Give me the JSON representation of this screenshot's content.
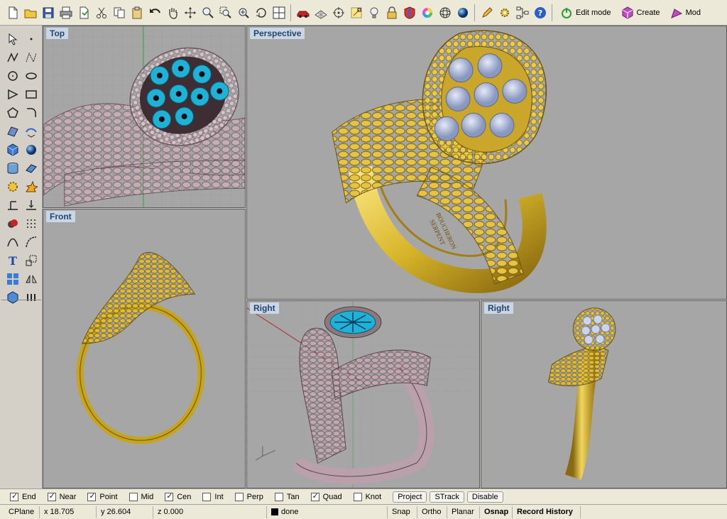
{
  "toolbar": {
    "icons": [
      "new-file-icon",
      "open-folder-icon",
      "save-icon",
      "print-icon",
      "import-icon",
      "cut-icon",
      "copy-icon",
      "paste-icon",
      "undo-icon",
      "pan-hand-icon",
      "rotate-view-icon",
      "zoom-icon",
      "zoom-window-icon",
      "zoom-extents-icon",
      "zoom-selected-icon",
      "four-viewports-icon",
      "car-icon",
      "grid-plane-icon",
      "point-icon",
      "osnap-icon",
      "lightbulb-icon",
      "lock-icon",
      "render-shield-icon",
      "color-wheel-icon",
      "sphere-wireframe-icon",
      "sphere-render-icon",
      "pencil-icon",
      "gear-settings-icon",
      "network-icon",
      "help-icon"
    ],
    "edit_mode_label": "Edit mode",
    "create_label": "Create",
    "mod_label": "Mod"
  },
  "viewports": {
    "top": "Top",
    "perspective": "Perspective",
    "front": "Front",
    "right1": "Right",
    "right2": "Right"
  },
  "engraving": {
    "line1": "BOUCHERON",
    "line2": "SERPENT"
  },
  "osnap": {
    "items": [
      {
        "label": "End",
        "checked": true
      },
      {
        "label": "Near",
        "checked": true
      },
      {
        "label": "Point",
        "checked": true
      },
      {
        "label": "Mid",
        "checked": false
      },
      {
        "label": "Cen",
        "checked": true
      },
      {
        "label": "Int",
        "checked": false
      },
      {
        "label": "Perp",
        "checked": false
      },
      {
        "label": "Tan",
        "checked": false
      },
      {
        "label": "Quad",
        "checked": true
      },
      {
        "label": "Knot",
        "checked": false
      }
    ],
    "buttons": [
      "Project",
      "STrack",
      "Disable"
    ]
  },
  "status": {
    "cplane": "CPlane",
    "x": "x 18.705",
    "y": "y 26.604",
    "z": "z 0.000",
    "layer": "done",
    "snap": "Snap",
    "ortho": "Ortho",
    "planar": "Planar",
    "osnap": "Osnap",
    "record_history": "Record History"
  },
  "colors": {
    "viewport_bg": "#a6a6a6",
    "gold": "#d8b62a",
    "mauve": "#b8a0a8",
    "gem_blue": "#1fb2d6",
    "label_bg": "#c9d6e6"
  }
}
